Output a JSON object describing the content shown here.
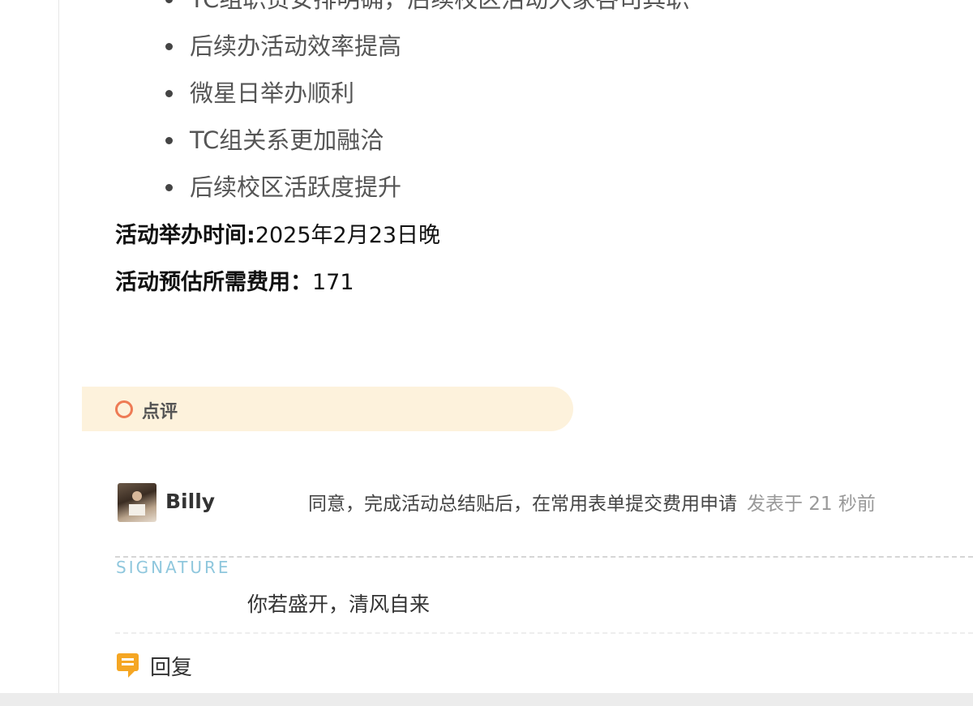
{
  "goals": [
    "TC组职责安排明确，后续校区活动大家各司其职",
    "后续办活动效率提高",
    "微星日举办顺利",
    "TC组关系更加融洽",
    "后续校区活跃度提升"
  ],
  "event": {
    "time_label": "活动举办时间:",
    "time_value": "2025年2月23日晚",
    "cost_label": "活动预估所需费用：",
    "cost_value": "171"
  },
  "review": {
    "title": "点评",
    "icon": "circle-icon",
    "accent": "#ee7b55",
    "banner_bg": "#fdf2dc"
  },
  "comment": {
    "user": "Billy",
    "text": "同意，完成活动总结贴后，在常用表单提交费用申请",
    "time": "发表于 21 秒前"
  },
  "signature": {
    "label": "SIGNATURE",
    "text": "你若盛开，清风自来"
  },
  "reply": {
    "label": "回复",
    "icon": "comment-icon",
    "color": "#f5a623"
  }
}
